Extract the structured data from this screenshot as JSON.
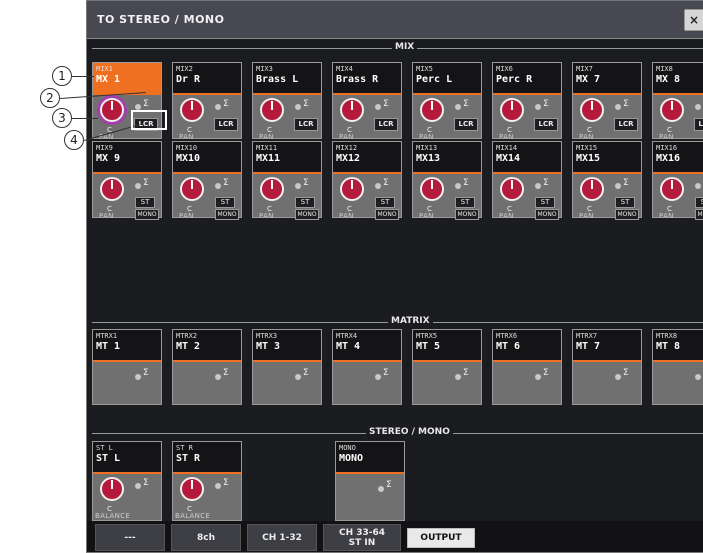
{
  "window": {
    "title": "TO STEREO / MONO",
    "close_label": "×"
  },
  "sections": {
    "mix": "MIX",
    "matrix": "MATRIX",
    "stereo_mono": "STEREO / MONO"
  },
  "mix_row1": [
    {
      "id": "MIX1",
      "name": "MX 1",
      "button": "LCR",
      "selected": true
    },
    {
      "id": "MIX2",
      "name": "Dr R",
      "button": "LCR"
    },
    {
      "id": "MIX3",
      "name": "Brass L",
      "button": "LCR"
    },
    {
      "id": "MIX4",
      "name": "Brass R",
      "button": "LCR"
    },
    {
      "id": "MIX5",
      "name": "Perc L",
      "button": "LCR"
    },
    {
      "id": "MIX6",
      "name": "Perc R",
      "button": "LCR"
    },
    {
      "id": "MIX7",
      "name": "MX 7",
      "button": "LCR"
    },
    {
      "id": "MIX8",
      "name": "MX 8",
      "button": "LCR"
    }
  ],
  "mix_row2": [
    {
      "id": "MIX9",
      "name": "MX 9"
    },
    {
      "id": "MIX10",
      "name": "MX10"
    },
    {
      "id": "MIX11",
      "name": "MX11"
    },
    {
      "id": "MIX12",
      "name": "MX12"
    },
    {
      "id": "MIX13",
      "name": "MX13"
    },
    {
      "id": "MIX14",
      "name": "MX14"
    },
    {
      "id": "MIX15",
      "name": "MX15"
    },
    {
      "id": "MIX16",
      "name": "MX16"
    }
  ],
  "matrix": [
    {
      "id": "MTRX1",
      "name": "MT 1"
    },
    {
      "id": "MTRX2",
      "name": "MT 2"
    },
    {
      "id": "MTRX3",
      "name": "MT 3"
    },
    {
      "id": "MTRX4",
      "name": "MT 4"
    },
    {
      "id": "MTRX5",
      "name": "MT 5"
    },
    {
      "id": "MTRX6",
      "name": "MT 6"
    },
    {
      "id": "MTRX7",
      "name": "MT 7"
    },
    {
      "id": "MTRX8",
      "name": "MT 8"
    }
  ],
  "stereo": [
    {
      "id": "ST L",
      "name": "ST L",
      "knob_label": "BALANCE"
    },
    {
      "id": "ST R",
      "name": "ST R",
      "knob_label": "BALANCE"
    }
  ],
  "mono": {
    "id": "MONO",
    "name": "MONO"
  },
  "labels": {
    "center": "C",
    "pan": "PAN",
    "st": "ST",
    "mono_btn": "MONO",
    "sigma": "Σ"
  },
  "tabs": [
    {
      "label": "---",
      "active": false
    },
    {
      "label": "8ch",
      "active": false
    },
    {
      "label": "CH 1-32",
      "active": false
    },
    {
      "label": "CH 33-64",
      "label2": "ST IN",
      "active": false
    },
    {
      "label": "OUTPUT",
      "active": true
    }
  ],
  "callouts": [
    "1",
    "2",
    "3",
    "4"
  ],
  "colors": {
    "accent": "#ef7021",
    "knob": "#b51a3c",
    "panel": "#1b1c20"
  }
}
